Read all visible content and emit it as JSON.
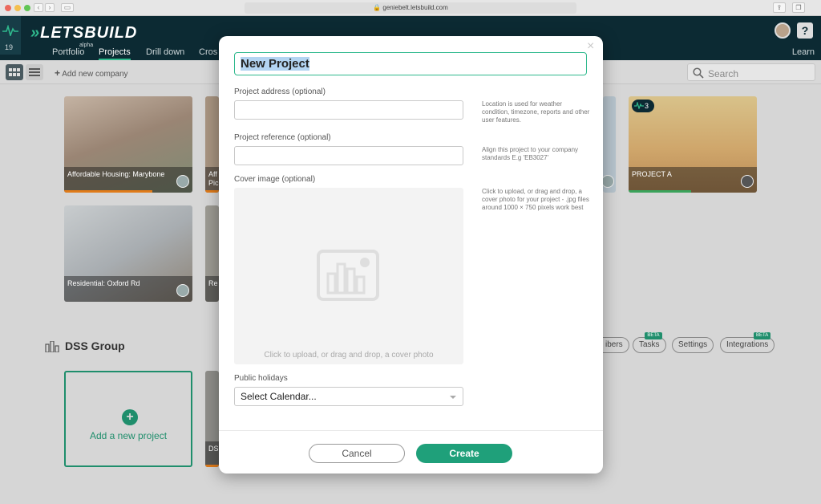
{
  "browser": {
    "url": "genieboltletsbuild.com",
    "url_display": "geniebelt.letsbuild.com"
  },
  "header": {
    "notification_count": "19",
    "brand": "LETSBUILD",
    "nav": [
      "Portfolio",
      "Projects",
      "Drill down",
      "Cros"
    ],
    "alpha_badge": "alpha",
    "learn": "Learn"
  },
  "toolbar": {
    "add_company": "Add new company",
    "search_placeholder": "Search"
  },
  "cards": [
    {
      "label": "Affordable Housing: Marybone",
      "bar_color": "#e07b1a"
    },
    {
      "label": "Aff Pic",
      "bar_color": "#e07b1a"
    },
    {
      "label": "PROJECT A",
      "badge": "3",
      "bar_color": "#3aa35b"
    },
    {
      "label": "Residential: Oxford Rd",
      "bar_color": "#9a9a9a"
    },
    {
      "label": "Re",
      "bar_color": "#9a9a9a"
    },
    {
      "label": "DS",
      "bar_color": "#e07b1a"
    }
  ],
  "group": {
    "title": "DSS Group",
    "buttons": [
      {
        "label": "ibers",
        "beta": ""
      },
      {
        "label": "Tasks",
        "beta": "BETA"
      },
      {
        "label": "Settings",
        "beta": ""
      },
      {
        "label": "Integrations",
        "beta": "BETA"
      }
    ],
    "add_project": "Add a new project"
  },
  "modal": {
    "title_value": "New Project",
    "address_label": "Project address (optional)",
    "address_hint": "Location is used for weather condition, timezone, reports and other user features.",
    "reference_label": "Project reference (optional)",
    "reference_hint": "Align this project to your company standards E.g 'EB3027'",
    "cover_label": "Cover image (optional)",
    "cover_hint": "Click to upload, or drag and drop, a cover photo for your project - .jpg files around 1000 × 750 pixels work best",
    "cover_placeholder": "Click to upload, or drag and drop, a cover photo",
    "holidays_label": "Public holidays",
    "holidays_value": "Select Calendar...",
    "cancel": "Cancel",
    "create": "Create",
    "close_glyph": "×"
  },
  "colors": {
    "accent": "#1fa07a",
    "header_bg": "#0c2a33"
  }
}
